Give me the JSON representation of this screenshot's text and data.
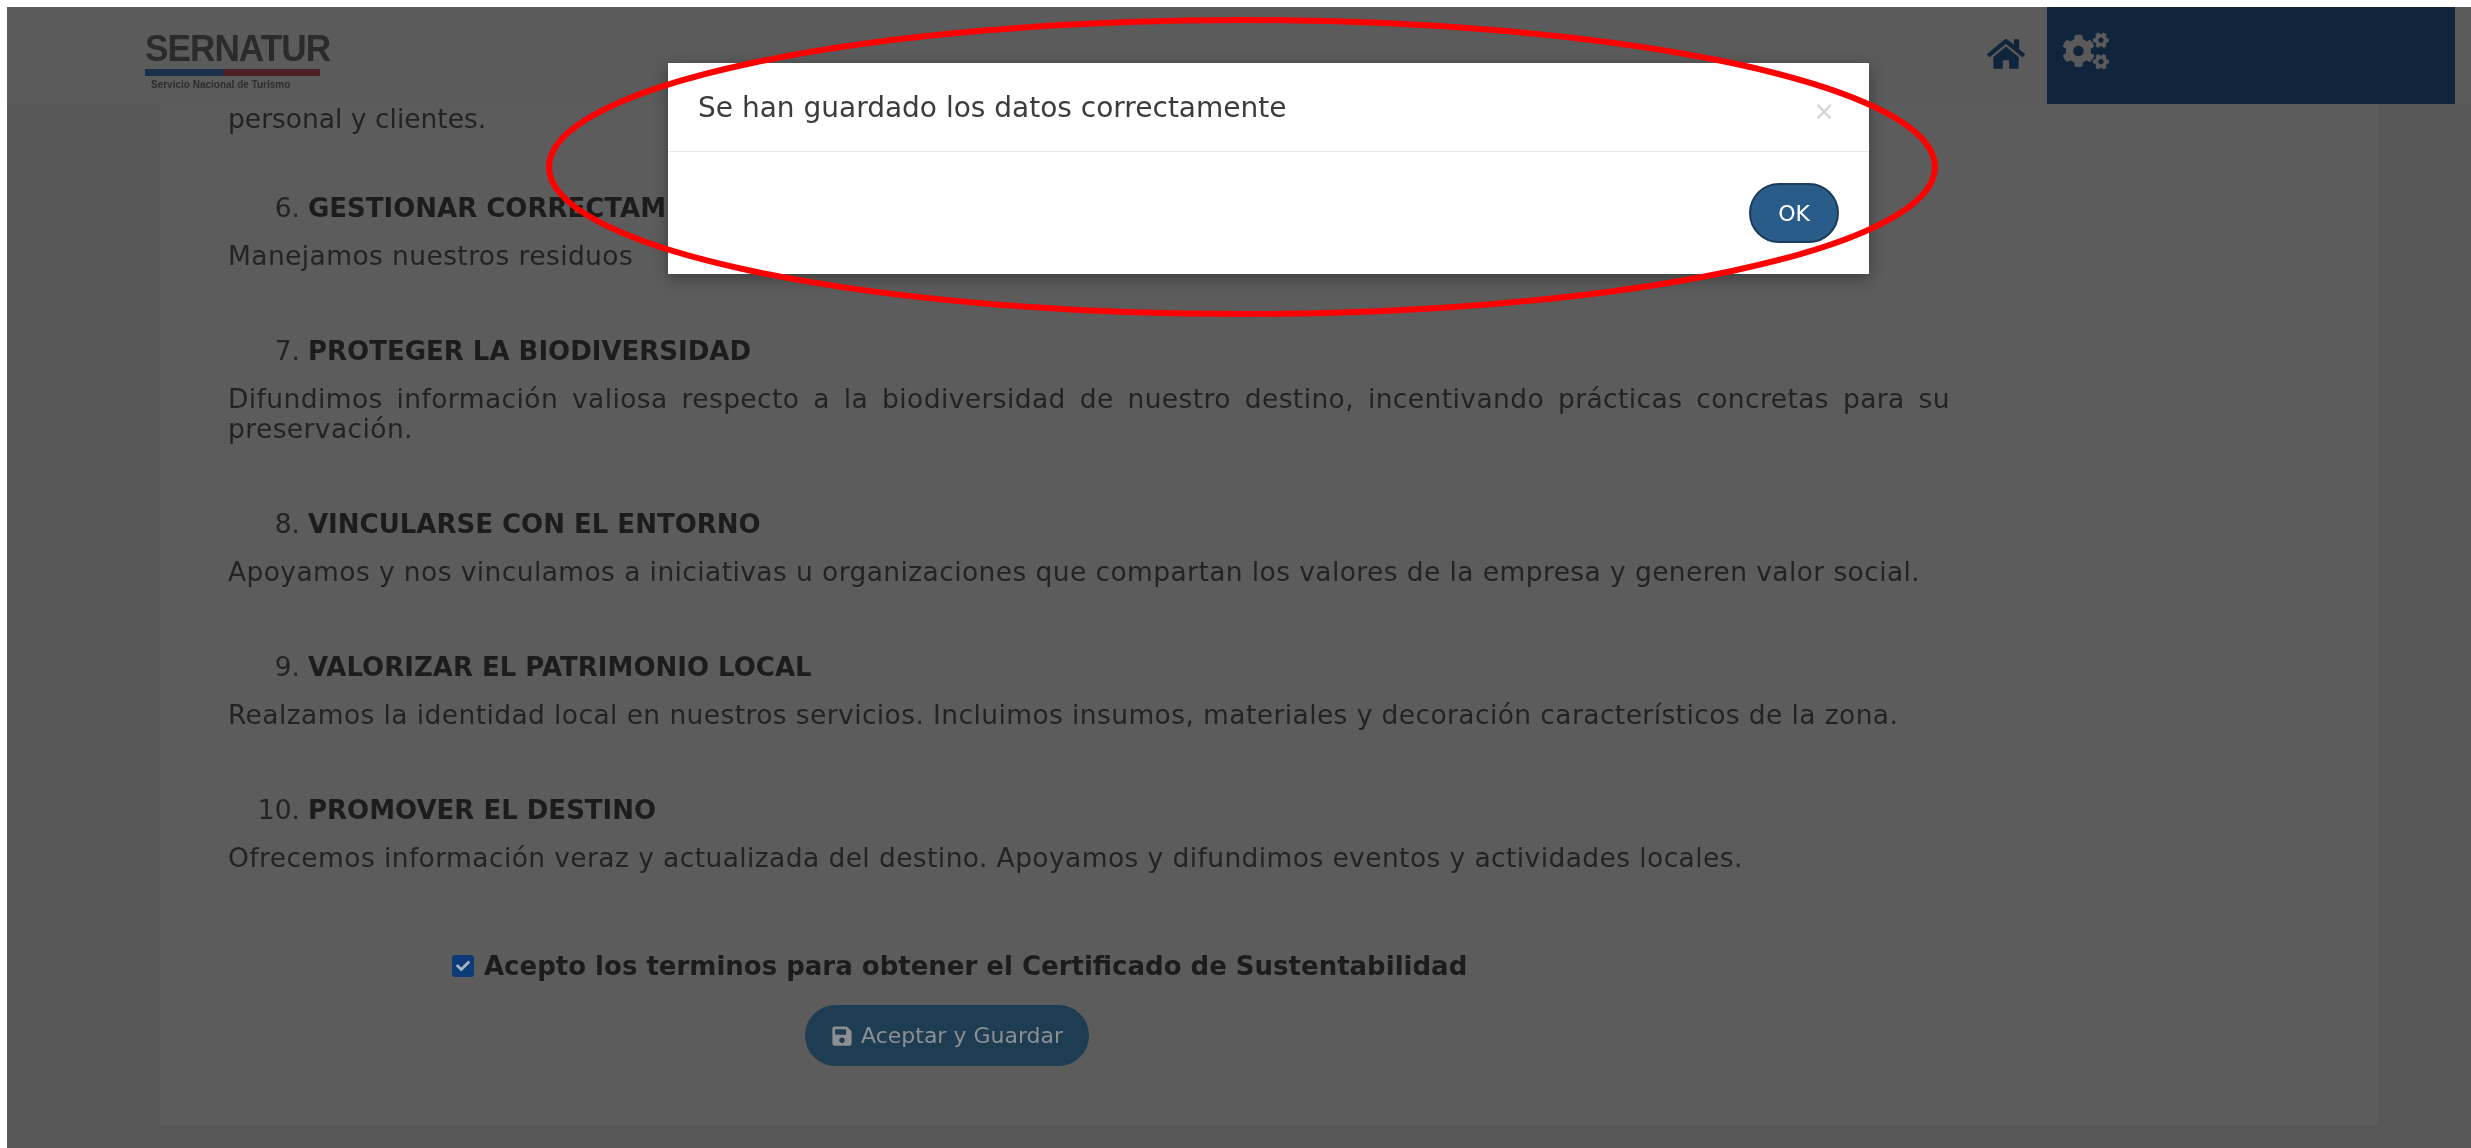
{
  "header": {
    "logo": {
      "name": "SERNATUR",
      "subtitle": "Servicio Nacional de Turismo"
    }
  },
  "content": {
    "intro_fragment": "personal y clientes.",
    "principles": [
      {
        "number": "6.",
        "title": "GESTIONAR CORRECTAM",
        "text": "Manejamos nuestros residuos"
      },
      {
        "number": "7.",
        "title": "PROTEGER LA BIODIVERSIDAD",
        "text": "Difundimos información valiosa respecto a la biodiversidad de nuestro destino, incentivando prácticas concretas para su preservación."
      },
      {
        "number": "8.",
        "title": "VINCULARSE CON EL ENTORNO",
        "text": "Apoyamos y nos vinculamos a iniciativas u organizaciones que compartan los valores de la empresa y generen valor social."
      },
      {
        "number": "9.",
        "title": "VALORIZAR EL PATRIMONIO LOCAL",
        "text": "Realzamos la identidad local en nuestros servicios. Incluimos insumos, materiales y decoración característicos de la zona."
      },
      {
        "number": "10.",
        "title": "PROMOVER EL DESTINO",
        "text": "Ofrecemos información veraz y actualizada del destino. Apoyamos y difundimos eventos y actividades locales."
      }
    ],
    "acceptance": {
      "label": "Acepto los terminos para obtener el Certificado de Sustentabilidad",
      "checked": true
    },
    "save_button": "Aceptar y Guardar"
  },
  "modal": {
    "message": "Se han guardado los datos correctamente",
    "close": "×",
    "ok": "OK"
  }
}
